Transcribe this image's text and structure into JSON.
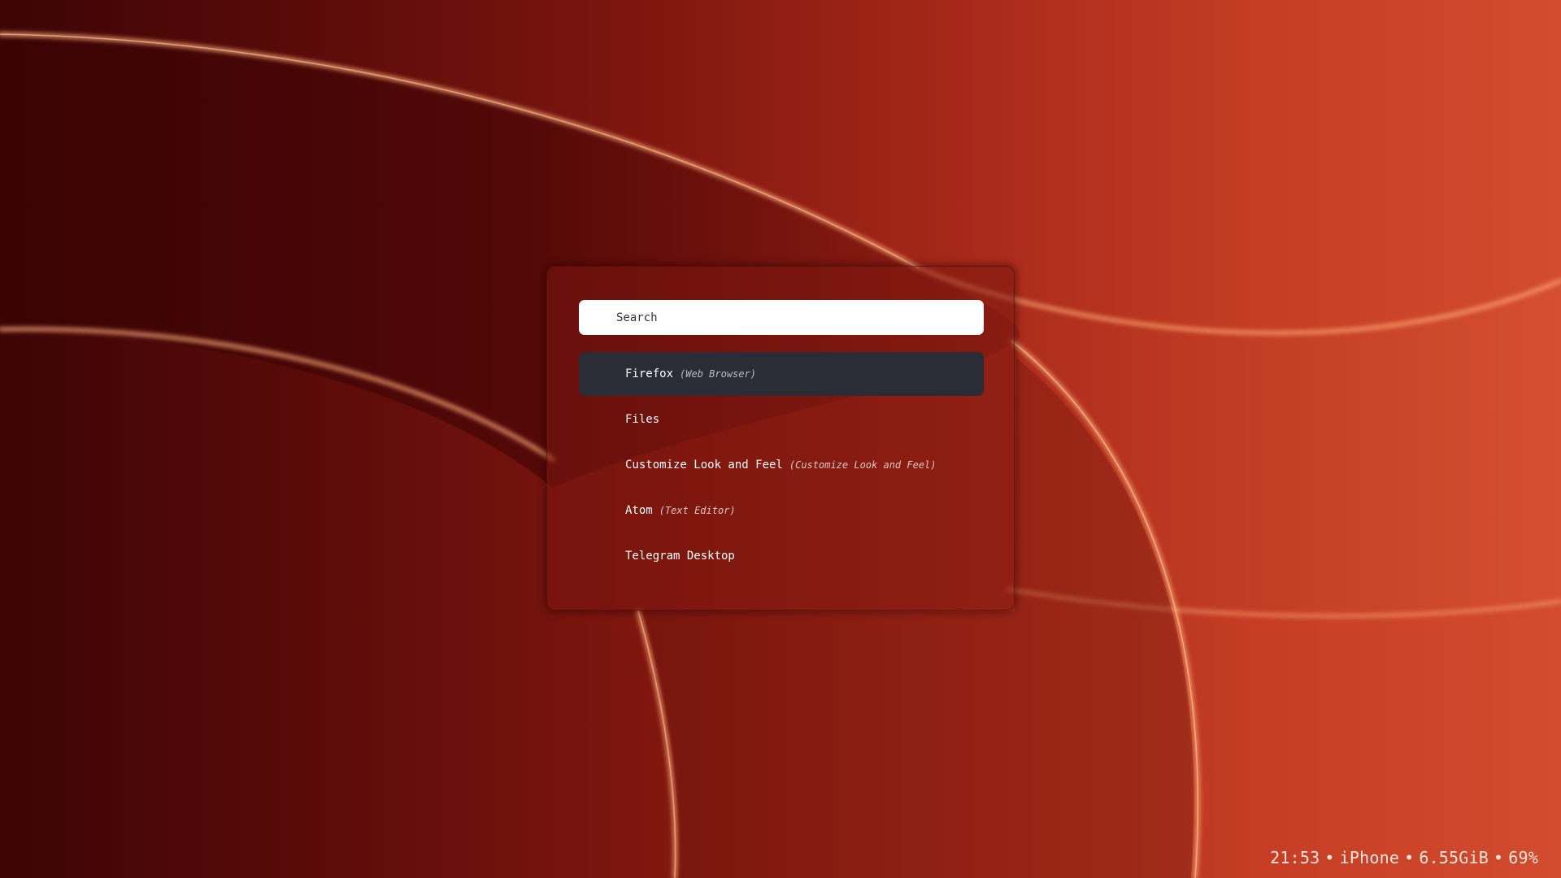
{
  "colors": {
    "accent_selected_row": "#2a2d36",
    "wallpaper_dark": "#3d0405",
    "wallpaper_light": "#d34c2f",
    "glow": "#ffb07a"
  },
  "search": {
    "placeholder": "Search",
    "value": ""
  },
  "results": [
    {
      "name": "Firefox",
      "description": "(Web Browser)",
      "selected": true
    },
    {
      "name": "Files",
      "description": "",
      "selected": false
    },
    {
      "name": "Customize Look and Feel",
      "description": "(Customize Look and Feel)",
      "selected": false
    },
    {
      "name": "Atom",
      "description": "(Text Editor)",
      "selected": false
    },
    {
      "name": "Telegram Desktop",
      "description": "",
      "selected": false
    }
  ],
  "status_bar": {
    "time": "21:53",
    "device": "iPhone",
    "memory": "6.55GiB",
    "battery": "69%",
    "separator": "•"
  }
}
